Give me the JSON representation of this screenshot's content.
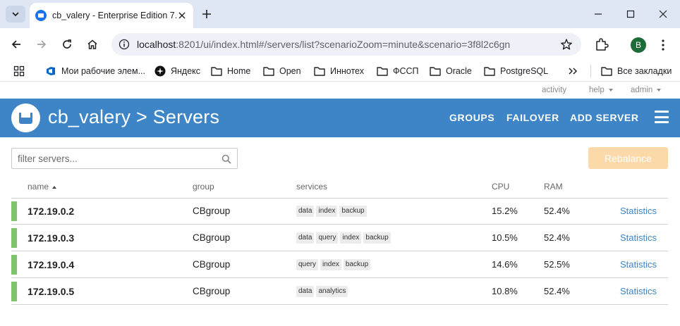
{
  "browser": {
    "tab_title": "cb_valery - Enterprise Edition 7.",
    "url_host": "localhost",
    "url_rest": ":8201/ui/index.html#/servers/list?scenarioZoom=minute&scenario=3f8l2c6gn",
    "profile_initial": "B",
    "bookmarks": [
      {
        "label": "Мои рабочие элем...",
        "icon": "azure-devops-icon"
      },
      {
        "label": "Яндекс",
        "icon": "yandex-icon"
      },
      {
        "label": "Home",
        "icon": "folder-icon"
      },
      {
        "label": "Open",
        "icon": "folder-icon"
      },
      {
        "label": "Иннотех",
        "icon": "folder-icon"
      },
      {
        "label": "ФССП",
        "icon": "folder-icon"
      },
      {
        "label": "Oracle",
        "icon": "folder-icon"
      },
      {
        "label": "PostgreSQL",
        "icon": "folder-icon"
      }
    ],
    "all_bookmarks": "Все закладки"
  },
  "topnav": {
    "activity": "activity",
    "help": "help",
    "admin": "admin"
  },
  "header": {
    "title": "cb_valery > Servers",
    "links": {
      "groups": "GROUPS",
      "failover": "FAILOVER",
      "add_server": "ADD SERVER"
    },
    "color": "#3d85c6"
  },
  "toolbar": {
    "filter_placeholder": "filter servers...",
    "rebalance_label": "Rebalance"
  },
  "table": {
    "columns": {
      "name": "name",
      "group": "group",
      "services": "services",
      "cpu": "CPU",
      "ram": "RAM"
    },
    "rows": [
      {
        "name": "172.19.0.2",
        "group": "CBgroup",
        "services": [
          "data",
          "index",
          "backup"
        ],
        "cpu": "15.2%",
        "ram": "52.4%",
        "stats": "Statistics"
      },
      {
        "name": "172.19.0.3",
        "group": "CBgroup",
        "services": [
          "data",
          "query",
          "index",
          "backup"
        ],
        "cpu": "10.5%",
        "ram": "52.4%",
        "stats": "Statistics"
      },
      {
        "name": "172.19.0.4",
        "group": "CBgroup",
        "services": [
          "query",
          "index",
          "backup"
        ],
        "cpu": "14.6%",
        "ram": "52.5%",
        "stats": "Statistics"
      },
      {
        "name": "172.19.0.5",
        "group": "CBgroup",
        "services": [
          "data",
          "analytics"
        ],
        "cpu": "10.8%",
        "ram": "52.4%",
        "stats": "Statistics"
      }
    ],
    "status_color": "#7dc46c"
  }
}
